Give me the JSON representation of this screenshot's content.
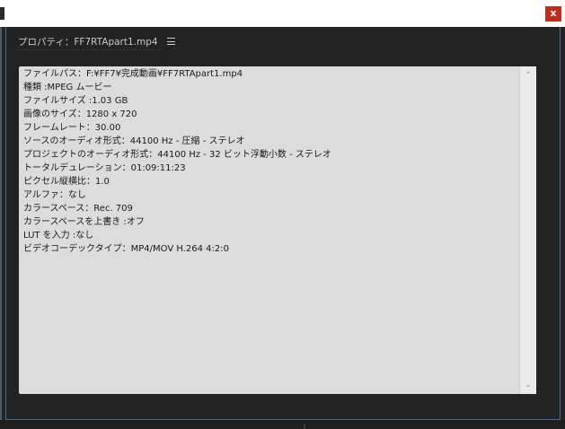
{
  "window": {
    "close_label": "x"
  },
  "panel": {
    "title": "プロパティ：FF7RTApart1.mp4",
    "menu_icon": "hamburger-menu-icon"
  },
  "properties": {
    "lines": [
      "ファイルパス：F:¥FF7¥完成動画¥FF7RTApart1.mp4",
      "種類 :MPEG ムービー",
      "ファイルサイズ :1.03 GB",
      "画像のサイズ：1280 x 720",
      "フレームレート：30.00",
      "ソースのオーディオ形式：44100 Hz - 圧縮 - ステレオ",
      "プロジェクトのオーディオ形式：44100 Hz - 32 ビット浮動小数 - ステレオ",
      "トータルデュレーション：01:09:11:23",
      "ピクセル縦横比：1.0",
      "アルファ：なし",
      "カラースペース：Rec. 709",
      "カラースペースを上書き :オフ",
      "LUT を入力 :なし",
      "ビデオコーデックタイプ：MP4/MOV H.264 4:2:0"
    ]
  },
  "scrollbar": {
    "up_icon": "chevron-up-icon",
    "down_icon": "chevron-down-icon"
  },
  "colors": {
    "panel_bg": "#232323",
    "content_bg": "#dcdcdc",
    "close_button": "#c42b1c",
    "frame_border": "#3a6ea5"
  }
}
